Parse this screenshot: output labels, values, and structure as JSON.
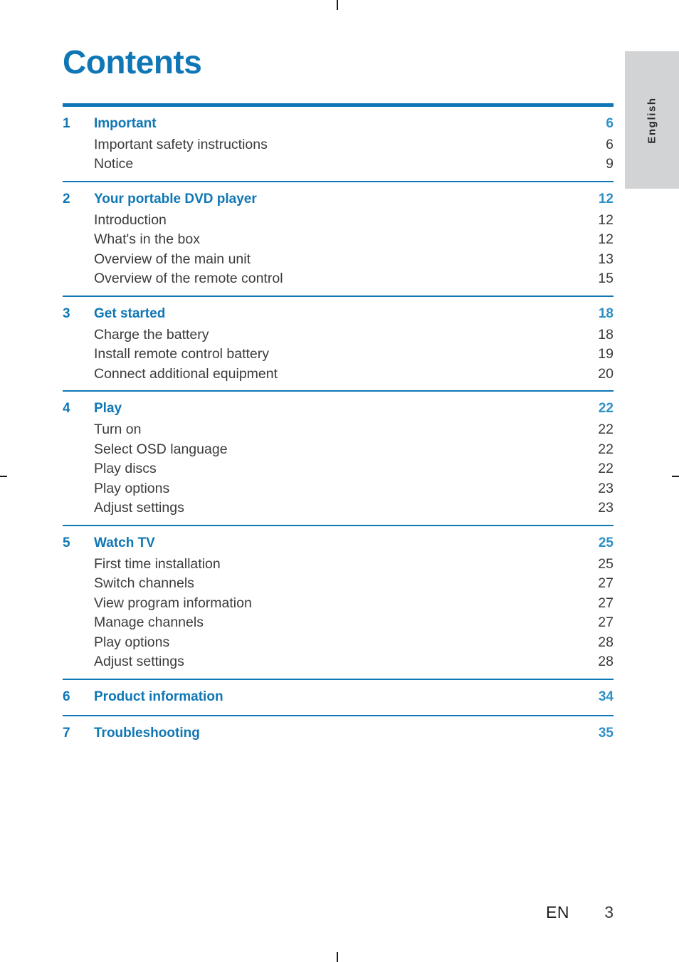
{
  "page": {
    "title": "Contents",
    "side_tab_label": "English",
    "footer_language_code": "EN",
    "footer_page_number": "3",
    "accent_color": "#0f77b5",
    "body_text_color": "#3b3b3b",
    "side_tab_bg": "#d2d3d5"
  },
  "toc": {
    "sections": [
      {
        "number": "1",
        "title": "Important",
        "page": "6",
        "entries": [
          {
            "title": "Important safety instructions",
            "page": "6"
          },
          {
            "title": "Notice",
            "page": "9"
          }
        ]
      },
      {
        "number": "2",
        "title": "Your portable DVD player",
        "page": "12",
        "entries": [
          {
            "title": "Introduction",
            "page": "12"
          },
          {
            "title": "What's in the box",
            "page": "12"
          },
          {
            "title": "Overview of the main unit",
            "page": "13"
          },
          {
            "title": "Overview of the remote control",
            "page": "15"
          }
        ]
      },
      {
        "number": "3",
        "title": "Get started",
        "page": "18",
        "entries": [
          {
            "title": "Charge the battery",
            "page": "18"
          },
          {
            "title": "Install remote control battery",
            "page": "19"
          },
          {
            "title": "Connect additional equipment",
            "page": "20"
          }
        ]
      },
      {
        "number": "4",
        "title": "Play",
        "page": "22",
        "entries": [
          {
            "title": "Turn on",
            "page": "22"
          },
          {
            "title": "Select OSD language",
            "page": "22"
          },
          {
            "title": "Play discs",
            "page": "22"
          },
          {
            "title": "Play options",
            "page": "23"
          },
          {
            "title": "Adjust settings",
            "page": "23"
          }
        ]
      },
      {
        "number": "5",
        "title": "Watch TV",
        "page": "25",
        "entries": [
          {
            "title": "First time installation",
            "page": "25"
          },
          {
            "title": "Switch channels",
            "page": "27"
          },
          {
            "title": "View program information",
            "page": "27"
          },
          {
            "title": "Manage channels",
            "page": "27"
          },
          {
            "title": "Play options",
            "page": "28"
          },
          {
            "title": "Adjust settings",
            "page": "28"
          }
        ]
      },
      {
        "number": "6",
        "title": "Product information",
        "page": "34",
        "entries": []
      },
      {
        "number": "7",
        "title": "Troubleshooting",
        "page": "35",
        "entries": []
      }
    ]
  }
}
